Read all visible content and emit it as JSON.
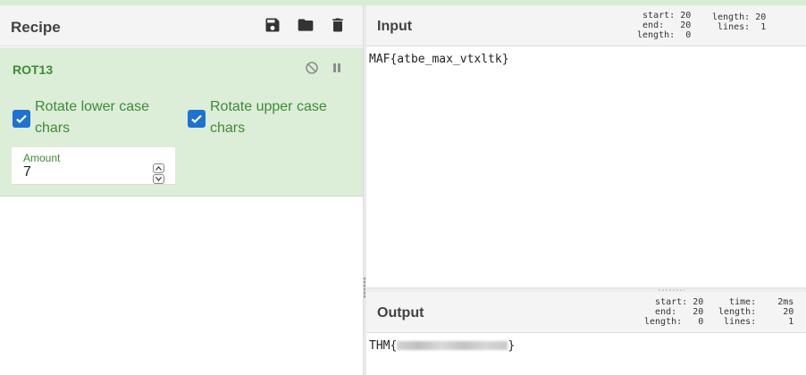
{
  "recipe": {
    "title": "Recipe",
    "icons": [
      "save-icon",
      "folder-open-icon",
      "trash-icon"
    ]
  },
  "operation": {
    "name": "ROT13",
    "icons": [
      "disable-icon",
      "pause-icon"
    ],
    "options": {
      "rotate_lower": {
        "label": "Rotate lower case chars",
        "checked": true
      },
      "rotate_upper": {
        "label": "Rotate upper case chars",
        "checked": true
      }
    },
    "amount": {
      "label": "Amount",
      "value": "7"
    }
  },
  "input": {
    "title": "Input",
    "stats": {
      "start_label": "start:",
      "start": "20",
      "end_label": "end:",
      "end": "20",
      "sel_length_label": "length:",
      "sel_length": "0",
      "length_label": "length:",
      "length": "20",
      "lines_label": "lines:",
      "lines": "1"
    },
    "text": "MAF{atbe_max_vtxltk}"
  },
  "output": {
    "title": "Output",
    "stats": {
      "start_label": "start:",
      "start": "20",
      "end_label": "end:",
      "end": "20",
      "sel_length_label": "length:",
      "sel_length": "0",
      "time_label": "time:",
      "time": "2ms",
      "length_label": "length:",
      "length": "20",
      "lines_label": "lines:",
      "lines": "1"
    },
    "text_prefix": "THM{",
    "text_suffix": "}"
  },
  "colors": {
    "accent_green": "#3d8b36",
    "operation_bg": "#dcedd8",
    "checkbox_blue": "#1e73d0",
    "header_bg": "#f4f4f4"
  }
}
